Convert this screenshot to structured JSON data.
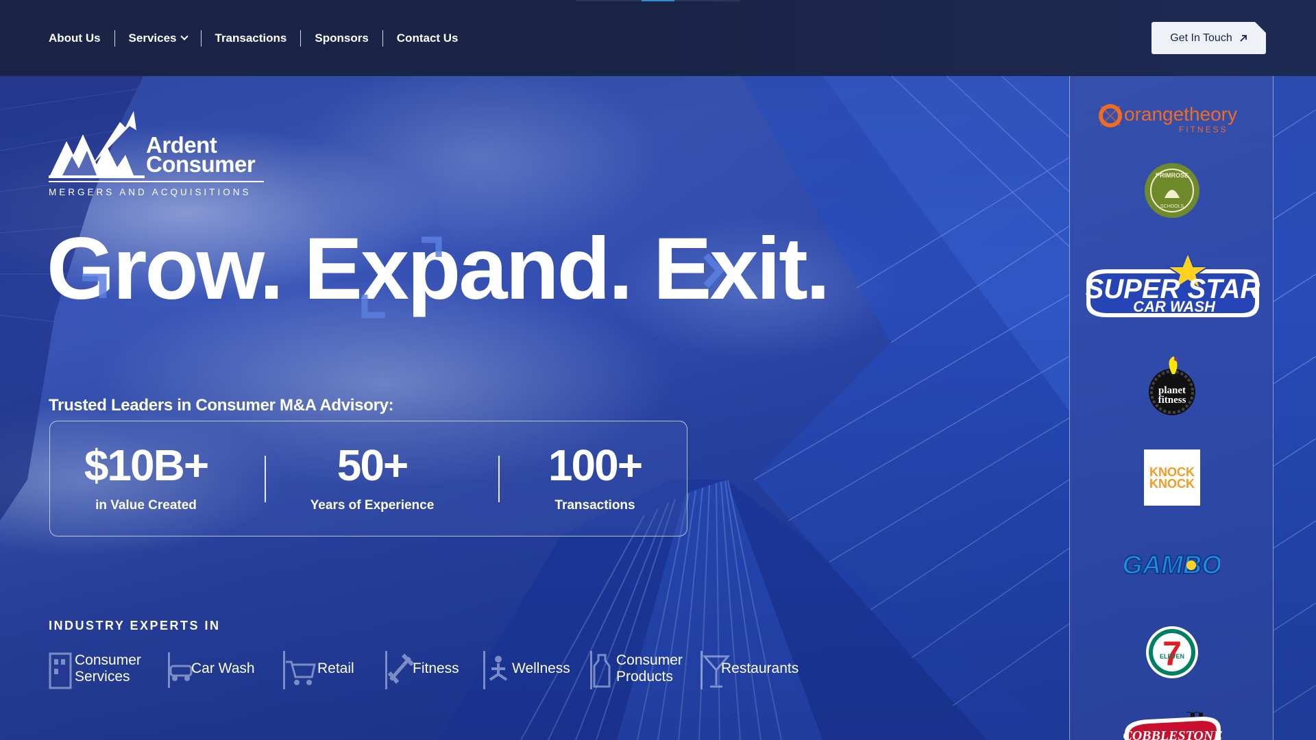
{
  "nav": {
    "links": [
      {
        "label": "About Us"
      },
      {
        "label": "Services"
      },
      {
        "label": "Transactions"
      },
      {
        "label": "Sponsors"
      },
      {
        "label": "Contact Us"
      }
    ],
    "cta_label": "Get In Touch"
  },
  "logo": {
    "line1": "Ardent",
    "line2": "Consumer",
    "tagline": "MERGERS AND ACQUISITIONS"
  },
  "headline": "Grow. Expand. Exit.",
  "trusted": {
    "title": "Trusted Leaders in Consumer M&A Advisory:",
    "stats": [
      {
        "value": "$10B+",
        "label": "in Value Created"
      },
      {
        "value": "50+",
        "label": "Years of Experience"
      },
      {
        "value": "100+",
        "label": "Transactions"
      }
    ]
  },
  "industries": {
    "title": "INDUSTRY EXPERTS IN",
    "items": [
      {
        "label": "Consumer Services",
        "icon": "building-icon"
      },
      {
        "label": "Car Wash",
        "icon": "car-wash-icon"
      },
      {
        "label": "Retail",
        "icon": "cart-icon"
      },
      {
        "label": "Fitness",
        "icon": "dumbbell-icon"
      },
      {
        "label": "Wellness",
        "icon": "wellness-icon"
      },
      {
        "label": "Consumer Products",
        "icon": "bottle-icon"
      },
      {
        "label": "Restaurants",
        "icon": "cocktail-icon"
      }
    ]
  },
  "sidebar": {
    "logos": [
      {
        "name": "orangetheory-logo",
        "text": "orangetheory",
        "sub": "FITNESS"
      },
      {
        "name": "primrose-logo",
        "text": "PRIMROSE",
        "sub": "SCHOOLS"
      },
      {
        "name": "superstar-logo",
        "text": "SUPER STAR",
        "sub": "CAR WASH"
      },
      {
        "name": "planet-fitness-logo",
        "text": "planet",
        "sub": "fitness"
      },
      {
        "name": "knock-knock-logo",
        "text": "KNOCK",
        "sub": "KNOCK"
      },
      {
        "name": "gambo-logo",
        "text": "GAMBO"
      },
      {
        "name": "seven-eleven-logo",
        "text": "7",
        "sub": "ELEVEN"
      },
      {
        "name": "cobblestone-logo",
        "text": "COBBLESTONE"
      }
    ]
  },
  "colors": {
    "nav_bg": "#1b2445",
    "accent_blue": "#4f74d9",
    "orangetheory": "#f26b21",
    "knock_knock": "#f59a23",
    "seven_eleven_green": "#008062",
    "seven_eleven_red": "#e31b23"
  }
}
